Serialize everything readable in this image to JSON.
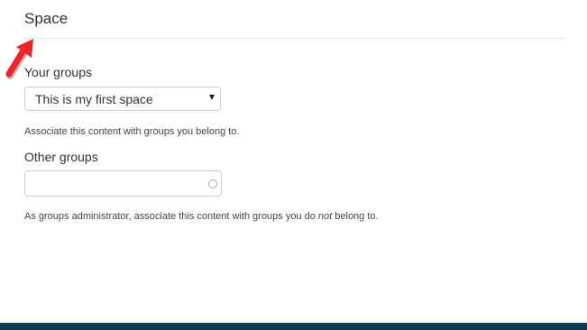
{
  "section": {
    "title": "Space"
  },
  "your_groups": {
    "label": "Your groups",
    "selected_value": "This is my first space",
    "help_text": "Associate this content with groups you belong to."
  },
  "other_groups": {
    "label": "Other groups",
    "value": "",
    "placeholder": "",
    "help_text_before": "As groups administrator, associate this content with groups you do ",
    "help_text_emphasis": "not",
    "help_text_after": " belong to."
  },
  "icons": {
    "annotation": "red-arrow-icon",
    "dropdown": "caret-down-icon",
    "autocomplete": "throbber-icon"
  },
  "colors": {
    "annotation_arrow": "#e8262b",
    "footer_bar": "#0d3b4f"
  }
}
